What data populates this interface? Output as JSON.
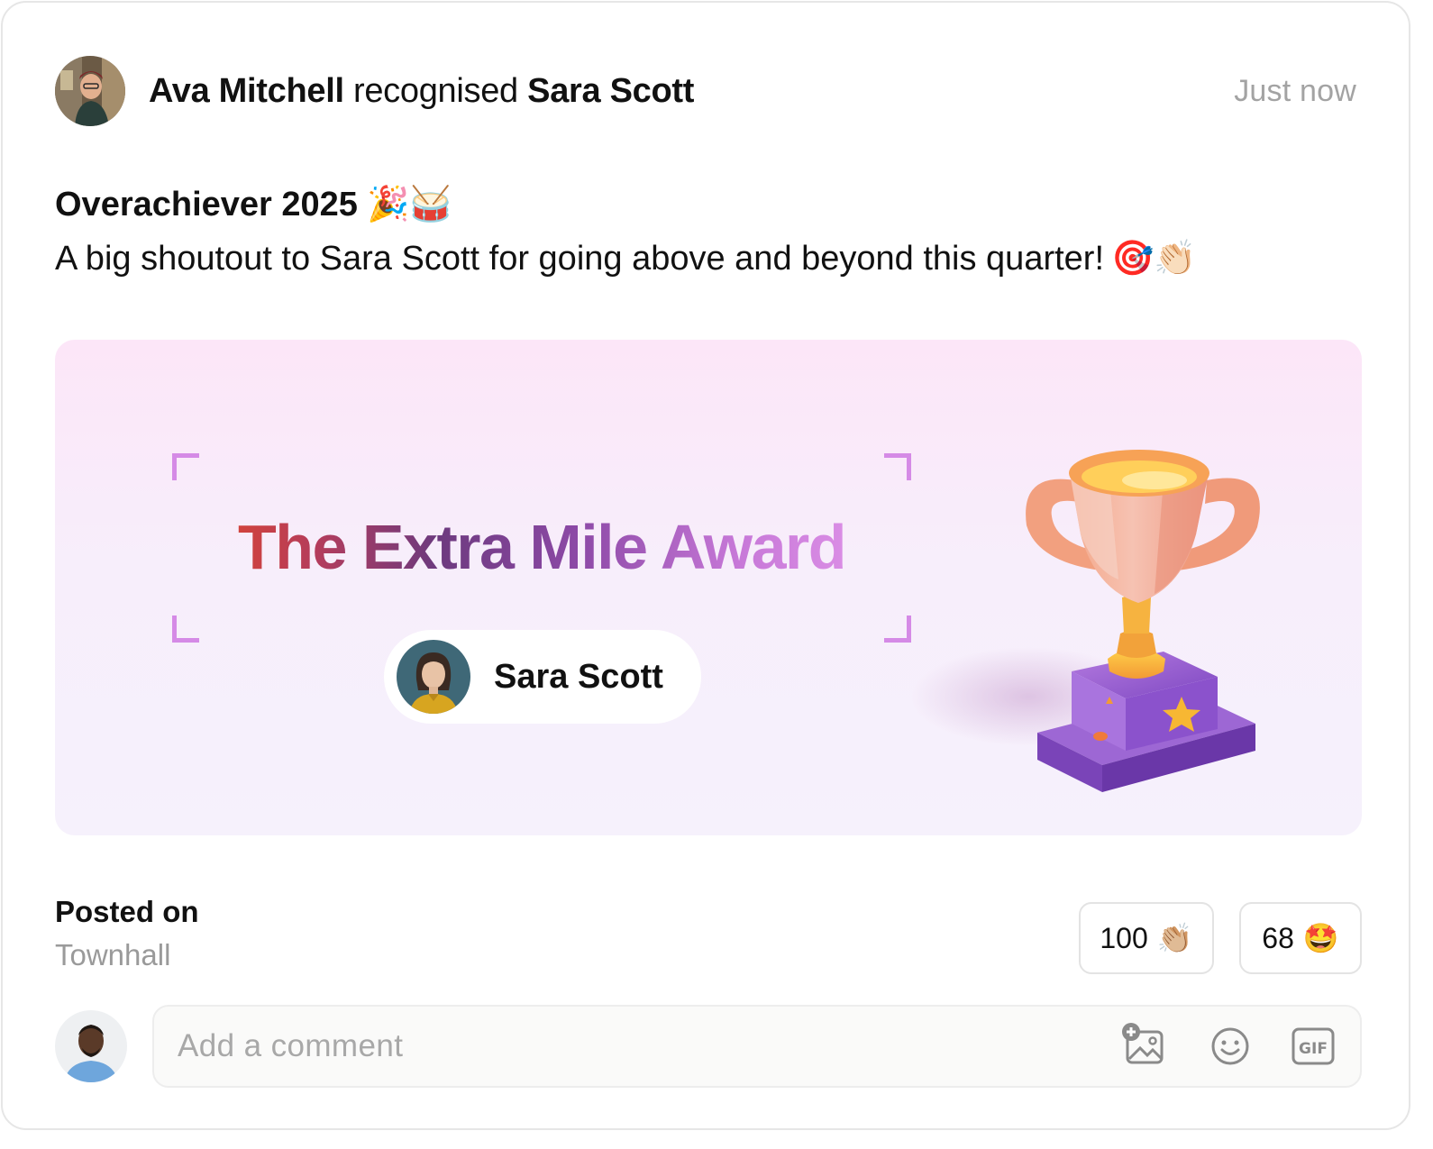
{
  "post": {
    "author": "Ava Mitchell",
    "action": "recognised",
    "recipient": "Sara Scott",
    "timestamp": "Just now",
    "title": "Overachiever 2025",
    "title_emojis": "🎉🥁",
    "message": "A big shoutout to Sara Scott for going above and beyond this quarter!",
    "message_emojis": "🎯👏🏻"
  },
  "award": {
    "title": "The Extra Mile Award",
    "recipient_name": "Sara Scott"
  },
  "footer": {
    "posted_label": "Posted on",
    "posted_value": "Townhall",
    "reactions": [
      {
        "count": "100",
        "emoji": "👏🏼"
      },
      {
        "count": "68",
        "emoji": "🤩"
      }
    ]
  },
  "comment": {
    "placeholder": "Add a comment",
    "tools": [
      "add-image-icon",
      "emoji-icon",
      "gif-icon"
    ]
  },
  "colors": {
    "bracket": "#d58ae6",
    "title_gradient": [
      "#e2472a",
      "#6d3a7e",
      "#e296ea"
    ],
    "muted_text": "#a3a3a3"
  }
}
